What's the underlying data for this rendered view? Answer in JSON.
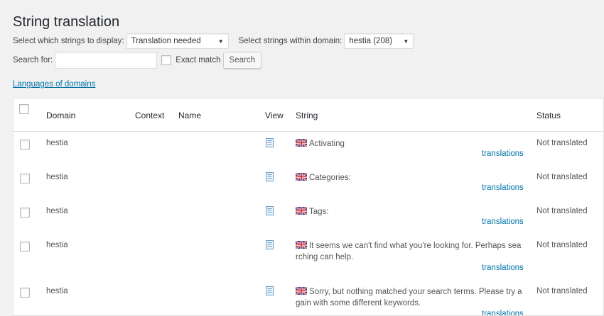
{
  "page": {
    "title": "String translation"
  },
  "filters": {
    "display_label": "Select which strings to display:",
    "display_value": "Translation needed",
    "domain_label": "Select strings within domain:",
    "domain_value": "hestia (208)",
    "search_label": "Search for:",
    "search_value": "",
    "exact_match_label": "Exact match",
    "exact_match_checked": false,
    "search_button": "Search"
  },
  "links": {
    "languages_of_domains": "Languages of domains"
  },
  "table": {
    "headers": {
      "domain": "Domain",
      "context": "Context",
      "name": "Name",
      "view": "View",
      "string": "String",
      "status": "Status"
    },
    "rows": [
      {
        "domain": "hestia",
        "context": "",
        "name": "",
        "string_line1": "Activating",
        "string_line2": "",
        "translations_link": "translations",
        "status": "Not translated"
      },
      {
        "domain": "hestia",
        "context": "",
        "name": "",
        "string_line1": "Categories:",
        "string_line2": "",
        "translations_link": "translations",
        "status": "Not translated"
      },
      {
        "domain": "hestia",
        "context": "",
        "name": "",
        "string_line1": "Tags:",
        "string_line2": "",
        "translations_link": "translations",
        "status": "Not translated"
      },
      {
        "domain": "hestia",
        "context": "",
        "name": "",
        "string_line1": "It seems we can't find what you're looking for. Perhaps sea",
        "string_line2": "rching can help.",
        "translations_link": "translations",
        "status": "Not translated"
      },
      {
        "domain": "hestia",
        "context": "",
        "name": "",
        "string_line1": "Sorry, but nothing matched your search terms. Please try a",
        "string_line2": "gain with some different keywords.",
        "translations_link": "translations",
        "status": "Not translated"
      }
    ]
  },
  "icons": {
    "view": "document-icon",
    "flag": "uk-flag-icon"
  },
  "colors": {
    "link": "#0073aa",
    "background": "#f1f1f1"
  }
}
